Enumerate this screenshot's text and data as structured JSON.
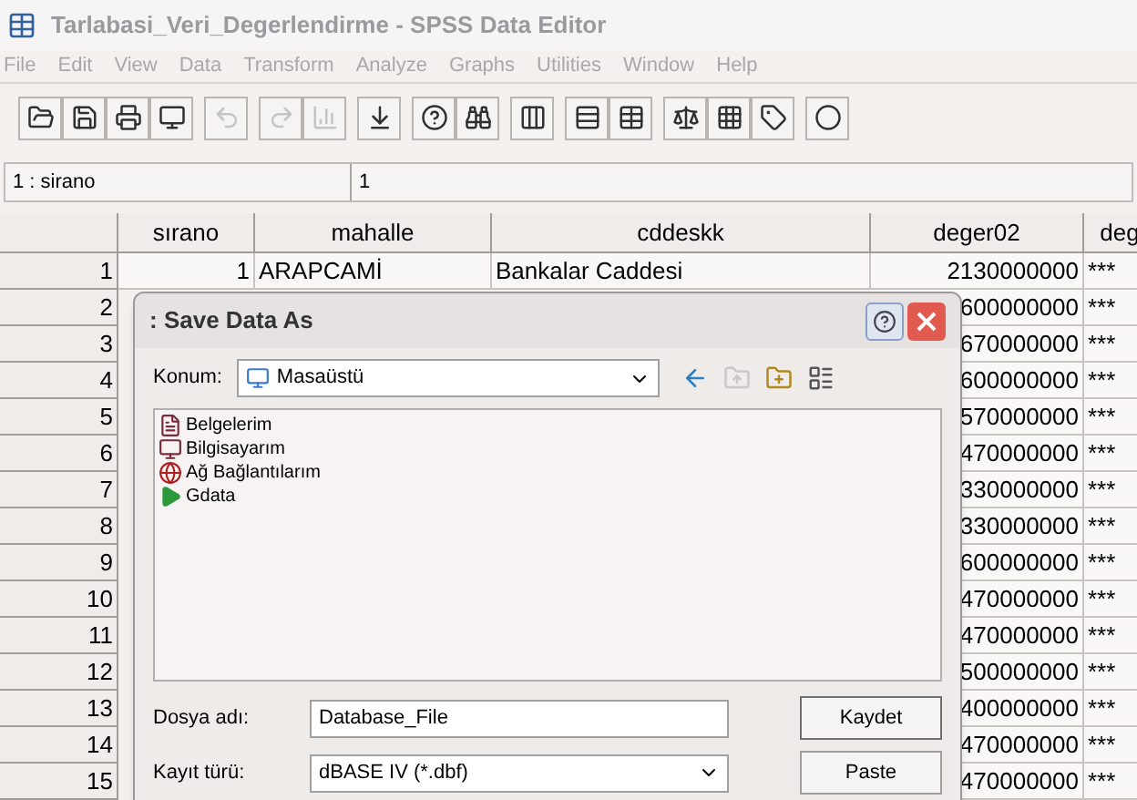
{
  "window": {
    "title": "Tarlabasi_Veri_Degerlendirme - SPSS Data Editor",
    "active": false
  },
  "menu": [
    "File",
    "Edit",
    "View",
    "Data",
    "Transform",
    "Analyze",
    "Graphs",
    "Utilities",
    "Window",
    "Help"
  ],
  "toolbar": [
    {
      "disabled": false
    },
    {
      "disabled": false
    },
    {
      "disabled": false
    },
    {
      "disabled": false
    },
    {
      "disabled": true
    },
    {
      "disabled": true
    },
    {
      "disabled": true
    },
    {
      "disabled": false
    },
    {
      "disabled": false
    },
    {
      "disabled": false
    },
    {
      "disabled": false
    },
    {
      "disabled": false
    },
    {
      "disabled": false
    },
    {
      "disabled": false
    },
    {
      "disabled": false
    },
    {
      "disabled": false
    },
    {
      "disabled": false
    }
  ],
  "cell_editor": {
    "reference": "1 : sirano",
    "value": "1"
  },
  "table": {
    "columns": [
      "sırano",
      "mahalle",
      "cddeskk",
      "deger02",
      "deg"
    ],
    "rows": [
      {
        "number": "1",
        "cells": [
          "1",
          "ARAPCAMİ",
          "Bankalar Caddesi",
          "2130000000",
          "***"
        ]
      },
      {
        "number": "2",
        "cells": [
          "",
          "",
          "",
          "600000000",
          "***"
        ]
      },
      {
        "number": "3",
        "cells": [
          "",
          "",
          "",
          "670000000",
          "***"
        ]
      },
      {
        "number": "4",
        "cells": [
          "",
          "",
          "",
          "600000000",
          "***"
        ]
      },
      {
        "number": "5",
        "cells": [
          "",
          "",
          "",
          "570000000",
          "***"
        ]
      },
      {
        "number": "6",
        "cells": [
          "",
          "",
          "",
          "470000000",
          "***"
        ]
      },
      {
        "number": "7",
        "cells": [
          "",
          "",
          "",
          "330000000",
          "***"
        ]
      },
      {
        "number": "8",
        "cells": [
          "",
          "",
          "",
          "330000000",
          "***"
        ]
      },
      {
        "number": "9",
        "cells": [
          "",
          "",
          "",
          "600000000",
          "***"
        ]
      },
      {
        "number": "10",
        "cells": [
          "",
          "",
          "",
          "470000000",
          "***"
        ]
      },
      {
        "number": "11",
        "cells": [
          "",
          "",
          "",
          "470000000",
          "***"
        ]
      },
      {
        "number": "12",
        "cells": [
          "",
          "",
          "",
          "500000000",
          "***"
        ]
      },
      {
        "number": "13",
        "cells": [
          "",
          "",
          "",
          "400000000",
          "***"
        ]
      },
      {
        "number": "14",
        "cells": [
          "",
          "",
          "",
          "470000000",
          "***"
        ]
      },
      {
        "number": "15",
        "cells": [
          "",
          "",
          "",
          "470000000",
          "***"
        ]
      }
    ]
  },
  "dialog": {
    "title": ": Save Data As",
    "location_label": "Konum:",
    "location": "Masaüstü",
    "items": [
      {
        "kind": "documents",
        "label": "Belgelerim"
      },
      {
        "kind": "computer",
        "label": "Bilgisayarım"
      },
      {
        "kind": "network",
        "label": "Ağ Bağlantılarım"
      },
      {
        "kind": "shortcut",
        "label": "Gdata"
      }
    ],
    "filename_label": "Dosya adı:",
    "filename": "Database_File",
    "filetype_label": "Kayıt türü:",
    "filetype": "dBASE IV (*.dbf)",
    "buttons": [
      "Kaydet",
      "Paste"
    ]
  }
}
